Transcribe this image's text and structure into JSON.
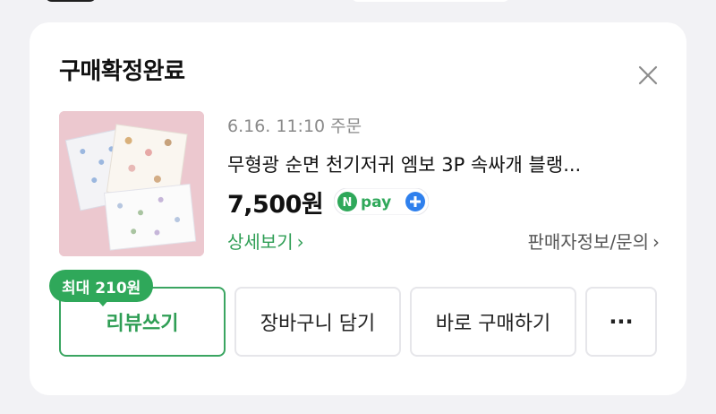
{
  "card": {
    "title": "구매확정완료"
  },
  "order": {
    "meta": "6.16. 11:10 주문",
    "product_name": "무형광 순면 천기저귀 엠보 3P 속싸개 블랭...",
    "price": "7,500원",
    "npay_label": "pay",
    "detail_link": "상세보기",
    "seller_link": "판매자정보/문의"
  },
  "actions": {
    "reward_badge": "최대 210원",
    "review": "리뷰쓰기",
    "cart": "장바구니 담기",
    "buy_again": "바로 구매하기",
    "more": "···"
  },
  "colors": {
    "accent_green": "#2fa85a",
    "npay_blue": "#2f80ed",
    "thumbnail_bg": "#ecc8cf"
  },
  "icons": {
    "close": "close-icon",
    "chevron": "chevron-right-icon",
    "more": "more-horizontal-icon"
  }
}
